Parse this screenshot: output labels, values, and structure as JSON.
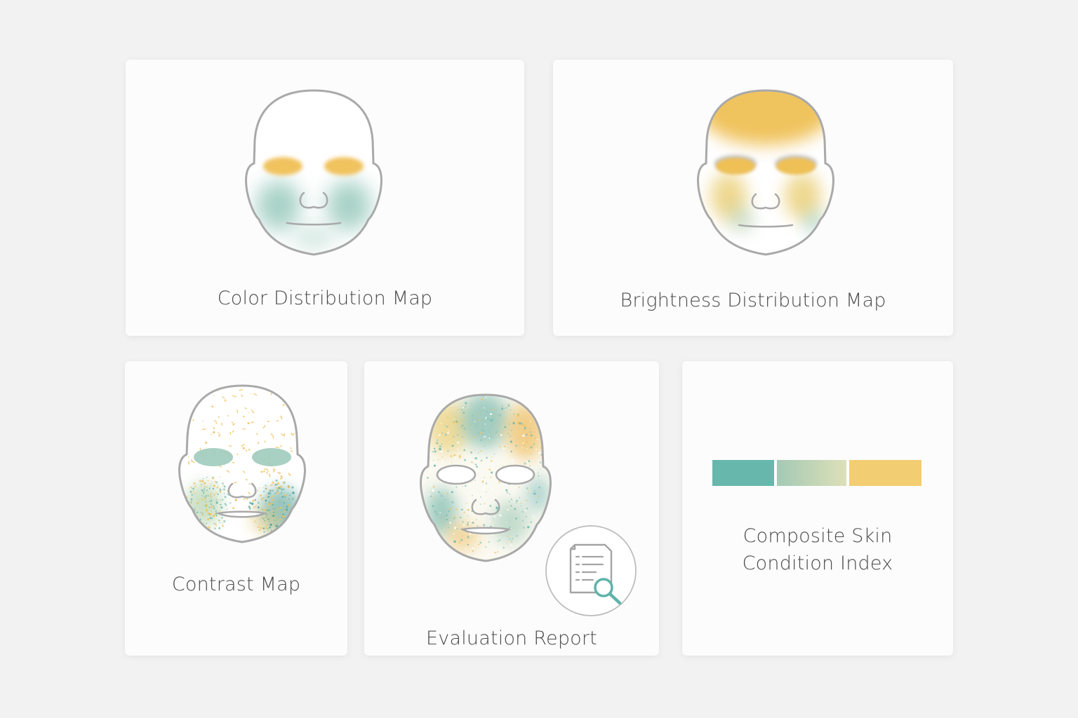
{
  "cards": {
    "color_distribution": {
      "title": "Color Distribution Map"
    },
    "brightness_distribution": {
      "title": "Brightness Distribution Map"
    },
    "contrast": {
      "title": "Contrast Map"
    },
    "evaluation_report": {
      "title": "Evaluation Report",
      "icon": "document-search-icon"
    },
    "composite_index": {
      "title_line1": "Composite Skin",
      "title_line2": "Condition Index",
      "scale_colors": [
        "#67b7ac",
        "#d3dcb4",
        "#f3cd72"
      ]
    }
  },
  "colors": {
    "teal": "#6bb8ad",
    "yellow": "#f0c25c",
    "outline": "#a9a9a9"
  }
}
